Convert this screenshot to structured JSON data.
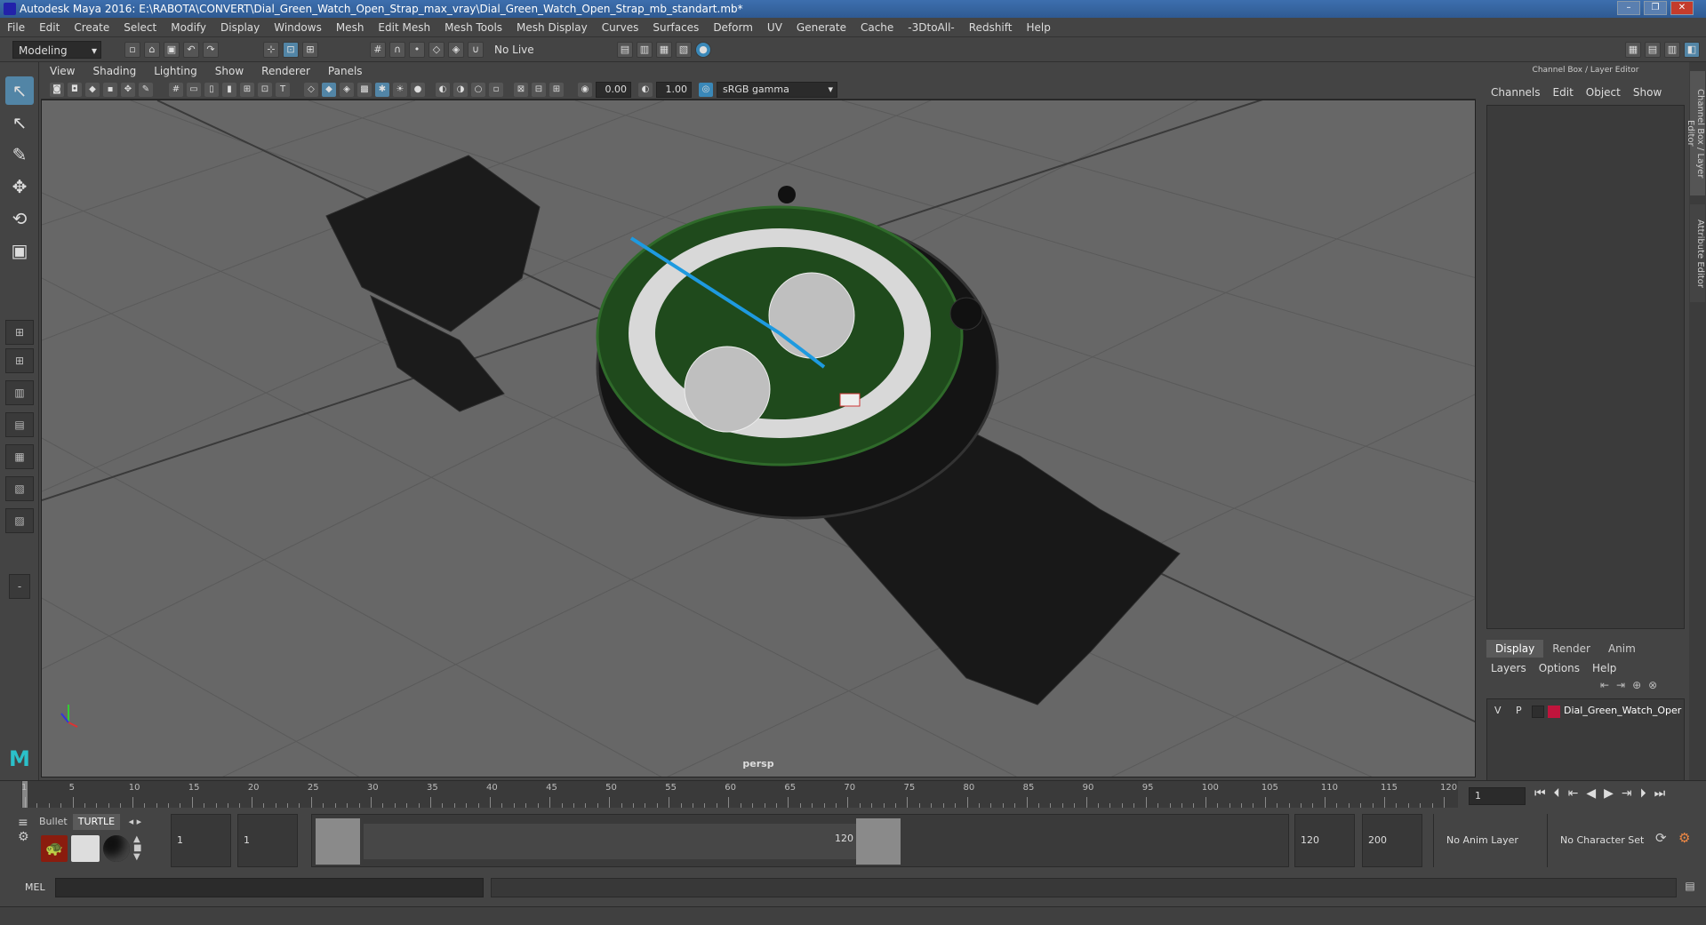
{
  "window": {
    "title": "Autodesk Maya 2016: E:\\RABOTA\\CONVERT\\Dial_Green_Watch_Open_Strap_max_vray\\Dial_Green_Watch_Open_Strap_mb_standart.mb*",
    "controls": [
      "–",
      "❐",
      "✕"
    ]
  },
  "menubar": [
    "File",
    "Edit",
    "Create",
    "Select",
    "Modify",
    "Display",
    "Windows",
    "Mesh",
    "Edit Mesh",
    "Mesh Tools",
    "Mesh Display",
    "Curves",
    "Surfaces",
    "Deform",
    "UV",
    "Generate",
    "Cache",
    "-3DtoAll-",
    "Redshift",
    "Help"
  ],
  "statusline": {
    "mode": "Modeling",
    "live_surface": "No Live Surface"
  },
  "viewport": {
    "menu": [
      "View",
      "Shading",
      "Lighting",
      "Show",
      "Renderer",
      "Panels"
    ],
    "field_a": "0.00",
    "field_b": "1.00",
    "color_space": "sRGB gamma",
    "camera_label": "persp"
  },
  "channelbox": {
    "title": "Channel Box / Layer Editor",
    "menu": [
      "Channels",
      "Edit",
      "Object",
      "Show"
    ]
  },
  "layer_editor": {
    "tabs": [
      "Display",
      "Render",
      "Anim"
    ],
    "menu": [
      "Layers",
      "Options",
      "Help"
    ],
    "layers": [
      {
        "v": "V",
        "p": "P",
        "name": "Dial_Green_Watch_Oper",
        "color": "#c0143c"
      }
    ]
  },
  "side_tabs": [
    "Channel Box / Layer Editor",
    "Attribute Editor"
  ],
  "timeline": {
    "ticks": [
      "1",
      "5",
      "10",
      "15",
      "20",
      "25",
      "30",
      "35",
      "40",
      "45",
      "50",
      "55",
      "60",
      "65",
      "70",
      "75",
      "80",
      "85",
      "90",
      "95",
      "100",
      "105",
      "110",
      "115",
      "120"
    ],
    "current_frame": "1"
  },
  "range": {
    "shelf_tabs": [
      "Bullet",
      "TURTLE"
    ],
    "start": "1",
    "playback_start": "1",
    "slider_start": "1",
    "slider_end": "120",
    "playback_end": "120",
    "end": "200",
    "anim_layer": "No Anim Layer",
    "character_set": "No Character Set"
  },
  "commandline": {
    "label": "MEL"
  },
  "colors": {
    "accent": "#5285a6",
    "viewport_bg": "#676767",
    "dial_green": "#1f4a1c",
    "hand_blue": "#1e9ae0"
  }
}
